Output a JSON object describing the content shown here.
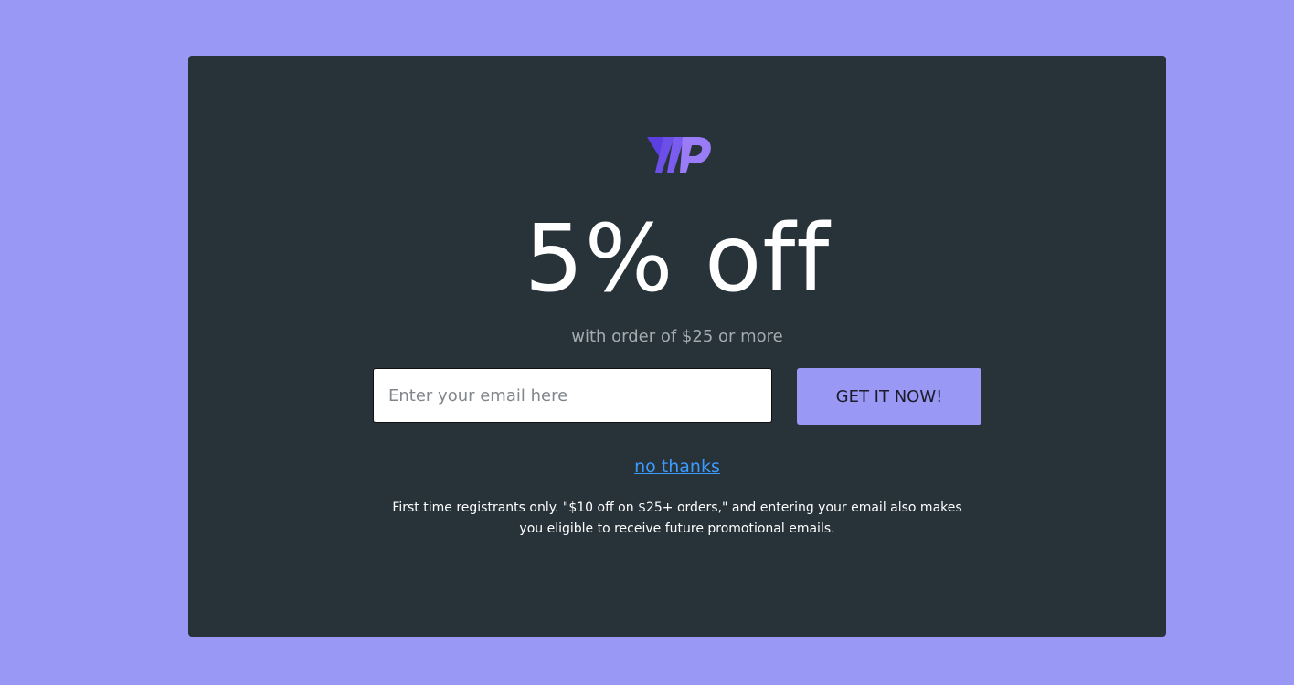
{
  "colors": {
    "page_background": "#9999f5",
    "modal_background": "#273239",
    "accent": "#9999f5",
    "logo_primary": "#6c4ee8",
    "logo_secondary": "#9b7cf7",
    "link": "#3d9bff",
    "subline": "#a5acb1"
  },
  "logo": {
    "icon": "wp-logo-icon"
  },
  "offer": {
    "headline": "5% off",
    "subline": "with order of $25 or more"
  },
  "form": {
    "email_placeholder": "Enter your email here",
    "email_value": "",
    "submit_label": "GET IT NOW!"
  },
  "dismiss": {
    "label": "no thanks"
  },
  "fine_print": {
    "text": "First time registrants only. \"$10 off on $25+ orders,\" and entering your email also makes you eligible to receive future promotional emails."
  }
}
